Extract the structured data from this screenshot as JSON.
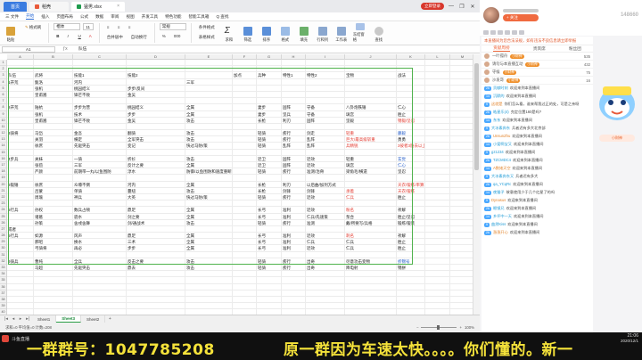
{
  "window": {
    "tabs": [
      {
        "label": "首页",
        "kind": "home"
      },
      {
        "label": "稻壳",
        "kind": "file"
      },
      {
        "label": "猛男.xlsx",
        "kind": "active"
      }
    ],
    "login_label": "立即登录",
    "controls": [
      "—",
      "❐",
      "✕"
    ]
  },
  "menu": [
    "三 文件",
    "开始",
    "插入",
    "页面布局",
    "公式",
    "数据",
    "审阅",
    "视图",
    "开发工具",
    "特色功能",
    "智能工具箱",
    "Q 查找"
  ],
  "menu_active_index": 1,
  "ribbon": {
    "font_name": "楷体",
    "font_size": "11",
    "buttons": [
      "粘贴",
      "格式刷",
      "合并居中",
      "自动换行",
      "常规",
      "条件格式",
      "表格样式",
      "求和",
      "筛选",
      "排序",
      "格式",
      "填充",
      "行和列",
      "工作表",
      "冻结窗格",
      "查找"
    ]
  },
  "formula_bar": {
    "cell": "A1",
    "content": "队伍"
  },
  "columns": [
    {
      "letter": "A",
      "w": 30
    },
    {
      "letter": "B",
      "w": 44
    },
    {
      "letter": "C",
      "w": 60
    },
    {
      "letter": "D",
      "w": 66
    },
    {
      "letter": "E",
      "w": 53
    },
    {
      "letter": "F",
      "w": 27
    },
    {
      "letter": "G",
      "w": 28
    },
    {
      "letter": "H",
      "w": 27
    },
    {
      "letter": "I",
      "w": 44
    },
    {
      "letter": "J",
      "w": 58
    },
    {
      "letter": "K",
      "w": 32
    },
    {
      "letter": "L",
      "w": 28
    },
    {
      "letter": "M",
      "w": 28
    },
    {
      "letter": "N",
      "w": 28
    }
  ],
  "sheet_rows": [
    [],
    [],
    [
      "队伍",
      "武将",
      "技能1",
      "技能2",
      "",
      "加点",
      "兵种",
      "特性1",
      "特性2",
      "宝物",
      "战法"
    ],
    [
      "1开荒",
      "甄洛",
      "河内",
      "",
      "三军",
      "",
      "",
      "",
      "",
      "",
      ""
    ],
    [
      "",
      "张机",
      "桃园结义",
      "步步/反间",
      "",
      "",
      "",
      "",
      "",
      "",
      ""
    ],
    [
      "",
      "皇甫嵩",
      "锋芒不败",
      "金吴",
      "",
      "",
      "",
      "",
      "",
      "",
      ""
    ],
    [
      "",
      "",
      "",
      "",
      "",
      "",
      "",
      "",
      "",
      "",
      ""
    ],
    [
      "2开荒",
      "陆抗",
      "步步为营",
      "桃园结义",
      "全属",
      "",
      "妻步",
      "固阵",
      "守备",
      "八卦炮铁锤",
      "仁心"
    ],
    [
      "",
      "张机",
      "技术",
      "步步",
      "全属",
      "",
      "妻步",
      "坚兵",
      "守备",
      "璃宫",
      "胜止"
    ],
    [
      "",
      "皇甫嵩",
      "锋芒不败",
      "金吴",
      "攻击",
      "",
      "长枪",
      "利刃",
      "固阵",
      "坚毅",
      "锦锻/坚忍"
    ],
    [
      "",
      "",
      "",
      "",
      "",
      "",
      "",
      "",
      "",
      "",
      ""
    ],
    [
      "3骑将",
      "马岱",
      "金吾",
      "翻骑",
      "攻击",
      "",
      "轻骑",
      "疾行",
      "剑走",
      "轻重",
      "藤毅"
    ],
    [
      "",
      "关羽",
      "横定",
      "全军突击",
      "攻击",
      "",
      "轻骑",
      "疾行",
      "乱阵",
      "巨大/最高级斩重",
      "勇勇"
    ],
    [
      "",
      "徐庶",
      "先驱突击",
      "变记",
      "快过马防/策",
      "",
      "轻骑",
      "乱阵",
      "乱阵",
      "兵精锐",
      "3彼者3防去以上猛击"
    ],
    [
      "",
      "",
      "",
      "",
      "",
      "",
      "",
      "",
      "",
      "",
      ""
    ],
    [
      "4步兵",
      "关妹",
      "一骑",
      "折衫",
      "攻击",
      "",
      "近卫",
      "固阵",
      "近效",
      "轻重",
      "玄觉"
    ],
    [
      "",
      "张苞",
      "三军",
      "反计之要",
      "全属",
      "",
      "近卫",
      "固阵",
      "近效",
      "璃宫",
      "仁心"
    ],
    [
      "",
      "严颜",
      "前期带一丸/以鱼围防",
      "淳水",
      "防御/以鱼围防和速度重断",
      "",
      "轻骑",
      "疾行",
      "准测/治骨",
      "梁角毛/横遗",
      "坚忍"
    ],
    [
      "",
      "",
      "",
      "",
      "",
      "",
      "",
      "",
      "",
      "",
      ""
    ],
    [
      "6锻锤",
      "徐庶",
      "众壕不倒",
      "河内",
      "全属",
      "",
      "长枪",
      "利刃",
      "以后曲/加剂方式",
      "",
      "天衣/锻练/率算"
    ],
    [
      "",
      "吕蒙",
      "单骑",
      "蔓纽",
      "攻击",
      "",
      "长枪",
      "剑锋",
      "剑锋",
      "承着",
      "天衣/锻练"
    ],
    [
      "",
      "周瑜",
      "神兵",
      "大英",
      "快过马防/策",
      "",
      "轻骑",
      "疾行",
      "近效",
      "仁兵",
      "胜止"
    ],
    [
      "",
      "",
      "",
      "",
      "",
      "",
      "",
      "",
      "",
      "",
      ""
    ],
    [
      "5行兵",
      "孙权",
      "数兵占顿",
      "鼎足",
      "全属",
      "",
      "长弓",
      "准利",
      "近效",
      "粉名",
      "祈解"
    ],
    [
      "",
      "诸葛",
      "骁水",
      "剑之要",
      "全属",
      "",
      "长弓",
      "准利",
      "仁兵/先速策",
      "泵合",
      "胜止/坚忍"
    ],
    [
      "",
      "孙策",
      "舍戌舍舞",
      "剑/通战术",
      "攻击",
      "",
      "轻骑",
      "疾行",
      "准测",
      "戴/所要写/兵格",
      "锻练/锻装"
    ],
    [
      "或者",
      "",
      "",
      "",
      "",
      "",
      "",
      "",
      "",
      "",
      ""
    ],
    [
      "5行兵",
      "如源",
      "风声",
      "鼎足",
      "全属",
      "",
      "长弓",
      "准利",
      "近效",
      "刺名",
      "祈解"
    ],
    [
      "",
      "郝昭",
      "换水",
      "三术",
      "全属",
      "",
      "长弓",
      "准利",
      "仁兵",
      "仁兵",
      "胜止"
    ],
    [
      "",
      "弓骑将",
      "再必",
      "步步",
      "全属",
      "",
      "长弓",
      "准利",
      "近效",
      "仁兵",
      "胜止"
    ],
    [
      "",
      "",
      "",
      "",
      "",
      "",
      "",
      "",
      "",
      "",
      ""
    ],
    [
      "9骑兵",
      "曹纯",
      "全兵",
      "反击之要",
      "攻击",
      "",
      "轻骑",
      "疾行",
      "出奇",
      "尽意功击变物",
      "折锦号"
    ],
    [
      "",
      "马超",
      "先驱突击",
      "鼎去",
      "攻击",
      "",
      "轻骑",
      "疾行",
      "出奇",
      "降电射",
      "锦拼"
    ],
    [],
    [],
    [],
    [],
    [],
    [],
    []
  ],
  "red_cells": [
    [
      11,
      9
    ],
    [
      12,
      9
    ],
    [
      13,
      9
    ],
    [
      13,
      10
    ],
    [
      9,
      10
    ],
    [
      19,
      10
    ],
    [
      20,
      9
    ],
    [
      20,
      10
    ],
    [
      21,
      9
    ],
    [
      23,
      9
    ],
    [
      27,
      9
    ]
  ],
  "blue_cells": [
    [
      11,
      10
    ],
    [
      15,
      10
    ],
    [
      16,
      10
    ],
    [
      31,
      10
    ]
  ],
  "sheet_tabs": [
    "Sheet1",
    "Sheet3",
    "Sheet2"
  ],
  "active_sheet_index": 1,
  "status": {
    "left": "求和=0  平均值=0  计数=208",
    "zoom": "100%"
  },
  "live": {
    "viewer_count": "148660",
    "follow_label": "+ 关注",
    "notice": "本直播间为您合法法规，如有违法不良信息请立即举报",
    "chat_tabs": [
      "贡献周榜",
      "贵宾席",
      "粉丝团"
    ],
    "ranking": [
      {
        "name": "一叶孤舟",
        "badge": "小财神",
        "score": "535"
      },
      {
        "name": "请勿与本直播互动",
        "badge": "小财神",
        "score": "432"
      },
      {
        "name": "守候",
        "badge": "小财神",
        "score": "75"
      },
      {
        "name": "沙发哥",
        "badge": "小财神",
        "score": "16"
      }
    ],
    "messages": [
      {
        "user": "贡献时刻",
        "text": "欢迎来到本直播间"
      },
      {
        "user": "沉默的",
        "text": "欢迎来到本直播间"
      },
      {
        "user": "这就是",
        "text": "你们怎么看，谁来帮我过正的处，可是之亲呀"
      },
      {
        "user": "皓星乐(4)",
        "text": "克定位置160是吗?"
      },
      {
        "user": "东东",
        "text": "欢迎来到本直播间"
      },
      {
        "user": "大冰素奔东",
        "text": "兵者迟有多大北京部"
      },
      {
        "user": "UnsunZhu",
        "text": "欢迎来到本直播间"
      },
      {
        "user": "小爱啊宝又",
        "text": "欢迎来到本直播间"
      },
      {
        "user": "gz1234",
        "text": "欢迎来到本直播间"
      },
      {
        "user": "TZCMDC4",
        "text": "欢迎来到本直播间"
      },
      {
        "user": "A数她天空",
        "text": "欢迎来到本直播间"
      },
      {
        "user": "大冰素奔东又",
        "text": "兵者迟有多大"
      },
      {
        "user": "qa_YCqRc",
        "text": "欢迎来到本直播间"
      },
      {
        "user": "夜猫子",
        "text": "故意使用少于几个红星了的吗"
      },
      {
        "user": "Dynasus",
        "text": "欢迎来到本直播间"
      },
      {
        "user": "眼镜兄",
        "text": "欢迎来到本直播间"
      },
      {
        "user": "乡坏中一天",
        "text": "欢迎来到本直播间"
      },
      {
        "user": "曲然Kiss",
        "text": "欢迎来到本直播间"
      },
      {
        "user": "涨涨开心",
        "text": "欢迎来到本直播间"
      }
    ],
    "side_chip": "小财神"
  },
  "taskbar": {
    "app_label": "斗鱼直播",
    "ticker": [
      "一群群号：1047785208",
      "原一群因为车速太快。。。。你们懂的。新一"
    ],
    "time": "21:06",
    "date": "2020/12/1"
  }
}
